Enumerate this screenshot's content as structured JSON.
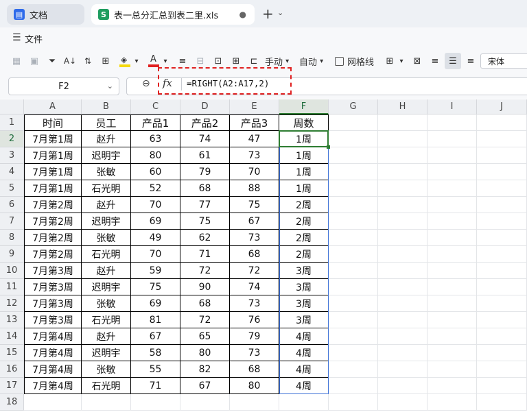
{
  "tabs": [
    {
      "label": "文档",
      "icon": "doc-icon",
      "active": false
    },
    {
      "label": "表一总分汇总到表二里.xls",
      "icon": "sheet-icon",
      "active": true
    }
  ],
  "menu": {
    "file_label": "文件"
  },
  "toolbar": {
    "manual_label": "手动",
    "auto_label": "自动",
    "gridlines_label": "网格线",
    "font_name": "宋体",
    "colors": {
      "fill": "#f5d90a",
      "font": "#e02020"
    }
  },
  "formula_bar": {
    "cell_ref": "F2",
    "fx_label": "fx",
    "formula": "=RIGHT(A2:A17,2)"
  },
  "sheet": {
    "columns": [
      "A",
      "B",
      "C",
      "D",
      "E",
      "F",
      "G",
      "H",
      "I",
      "J"
    ],
    "row_numbers": [
      "1",
      "2",
      "3",
      "4",
      "5",
      "6",
      "7",
      "8",
      "9",
      "10",
      "11",
      "12",
      "13",
      "14",
      "15",
      "16",
      "17",
      "18"
    ],
    "headers": [
      "时间",
      "员工",
      "产品1",
      "产品2",
      "产品3",
      "周数"
    ],
    "rows": [
      [
        "7月第1周",
        "赵升",
        "63",
        "74",
        "47",
        "1周"
      ],
      [
        "7月第1周",
        "迟明宇",
        "80",
        "61",
        "73",
        "1周"
      ],
      [
        "7月第1周",
        "张敏",
        "60",
        "79",
        "70",
        "1周"
      ],
      [
        "7月第1周",
        "石光明",
        "52",
        "68",
        "88",
        "1周"
      ],
      [
        "7月第2周",
        "赵升",
        "70",
        "77",
        "75",
        "2周"
      ],
      [
        "7月第2周",
        "迟明宇",
        "69",
        "75",
        "67",
        "2周"
      ],
      [
        "7月第2周",
        "张敏",
        "49",
        "62",
        "73",
        "2周"
      ],
      [
        "7月第2周",
        "石光明",
        "70",
        "71",
        "68",
        "2周"
      ],
      [
        "7月第3周",
        "赵升",
        "59",
        "72",
        "72",
        "3周"
      ],
      [
        "7月第3周",
        "迟明宇",
        "75",
        "90",
        "74",
        "3周"
      ],
      [
        "7月第3周",
        "张敏",
        "69",
        "68",
        "73",
        "3周"
      ],
      [
        "7月第3周",
        "石光明",
        "81",
        "72",
        "76",
        "3周"
      ],
      [
        "7月第4周",
        "赵升",
        "67",
        "65",
        "79",
        "4周"
      ],
      [
        "7月第4周",
        "迟明宇",
        "58",
        "80",
        "73",
        "4周"
      ],
      [
        "7月第4周",
        "张敏",
        "55",
        "82",
        "68",
        "4周"
      ],
      [
        "7月第4周",
        "石光明",
        "71",
        "67",
        "80",
        "4周"
      ]
    ],
    "active_cell": "F2",
    "accent_color": "#2e7d32",
    "range_color": "#3b6fd6"
  }
}
